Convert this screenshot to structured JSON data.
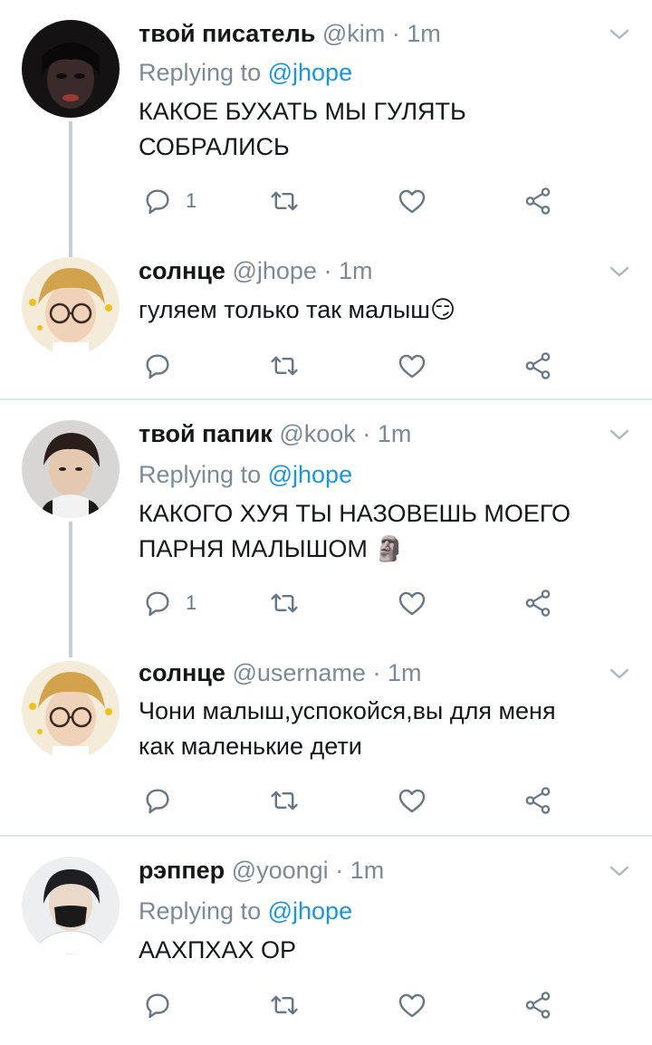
{
  "tweets": [
    {
      "name": "твой писатель",
      "handle": "@kim",
      "time": "1m",
      "separator": "·",
      "replying_label": "Replying to",
      "replying_handle": "@jhope",
      "text_lines": [
        "КАКОЕ БУХАТЬ МЫ ГУЛЯТЬ",
        "СОБРАЛИСЬ"
      ],
      "reply_count": "1"
    },
    {
      "name": "солнце",
      "handle": "@jhope",
      "time": "1m",
      "separator": "·",
      "text_lines": [
        "гуляем только так малыш"
      ],
      "emoji": "😏"
    },
    {
      "name": "твой папик",
      "handle": "@kook",
      "time": "1m",
      "separator": "·",
      "replying_label": "Replying to",
      "replying_handle": "@jhope",
      "text_lines": [
        "КАКОГО ХУЯ ТЫ НАЗОВЕШЬ МОЕГО",
        "ПАРНЯ МАЛЫШОМ"
      ],
      "emoji": "🗿",
      "reply_count": "1"
    },
    {
      "name": "солнце",
      "handle": "@username",
      "time": "1m",
      "separator": "·",
      "text_lines": [
        "Чони малыш,успокойся,вы для меня",
        "как маленькие дети"
      ]
    },
    {
      "name": "рэппер",
      "handle": "@yoongi",
      "time": "1m",
      "separator": "·",
      "replying_label": "Replying to",
      "replying_handle": "@jhope",
      "text_lines": [
        "ААХПХАХ ОР"
      ]
    }
  ],
  "icons": {
    "reply": "reply-icon",
    "retweet": "retweet-icon",
    "like": "heart-icon",
    "share": "share-icon",
    "menu": "chevron-down-icon"
  },
  "colors": {
    "text": "#14171a",
    "meta": "#7b8a97",
    "link": "#1b95e0",
    "thread_line": "#c4cfd6",
    "icon": "#657786",
    "divider": "#e1e8ed"
  }
}
